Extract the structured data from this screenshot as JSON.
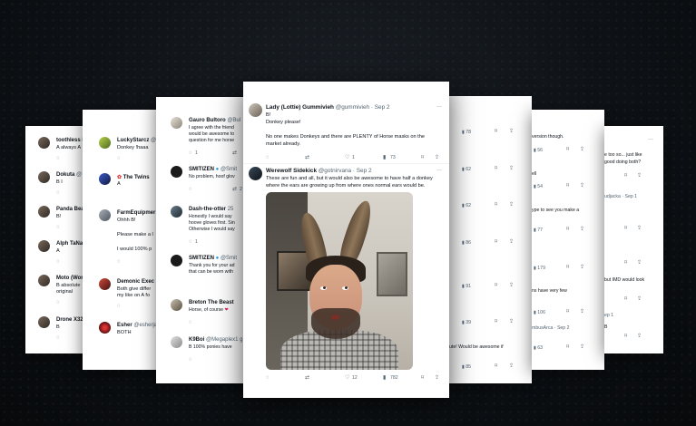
{
  "c1": {
    "tweets": [
      {
        "name": "toothless l",
        "text": "A always A"
      },
      {
        "name": "Dokuta",
        "handle": "@",
        "text": "B I"
      },
      {
        "name": "Panda Bea",
        "text": "B!"
      },
      {
        "name": "Alph TaNa",
        "text": "A"
      },
      {
        "name": "Moto (Wor",
        "text1": "B absolute",
        "text2": "original"
      },
      {
        "name": "Drone X32",
        "text": "B"
      }
    ]
  },
  "c2": {
    "t1": {
      "name": "LuckyStarcz",
      "handle": "@",
      "text": "Donkey !haaa"
    },
    "t2": {
      "name": "The Twins",
      "text": "A"
    },
    "t3": {
      "name": "FarmEquipmer",
      "text1": "Ohhh B!",
      "text2": "Please make a l",
      "text3": "I would 100% p"
    },
    "t4": {
      "name": "Demonic Exec",
      "text1": "Both give differ",
      "text2": "my like on A fo"
    },
    "t5": {
      "name": "Esher",
      "handle": "@esherja",
      "text": "BOTH"
    }
  },
  "c3": {
    "t1": {
      "name": "Gauro Bultoro",
      "handle": "@Bul",
      "text": [
        "I agree with the friend",
        "would be awesome to",
        "question for me horse"
      ],
      "likes": "1"
    },
    "t2": {
      "name": "SMITIZEN",
      "handle": "@Smit",
      "text": "No problem, hoof glov",
      "replies": "2"
    },
    "t3": {
      "name": "Dash-the-otter",
      "handle": "25",
      "text": [
        "Honestly I would say",
        "hoove gloves first. Sin",
        "Otherwise I would say"
      ],
      "likes": "1"
    },
    "t4": {
      "name": "SMITIZEN",
      "handle": "@Smit",
      "text": [
        "Thank you for your ad",
        "that can be worn with"
      ]
    },
    "t5": {
      "name": "Breton The Beast",
      "text": "Horse, of course"
    },
    "t6": {
      "name": "K9Boi",
      "handle": "@Megaplex1",
      "text": "B 100% ponies have",
      "extra": "g"
    }
  },
  "main": {
    "t1": {
      "name": "Lady (Lottie) Gummivieh",
      "handle": "@gummivieh · Sep 2",
      "text1": "B!",
      "text2": "Donkey please!",
      "text3": "No one makes Donkeys and there are PLENTY of Horse masks on the",
      "text4": "market already.",
      "likes": "1",
      "views": "73"
    },
    "t2": {
      "name": "Werewolf Sidekick",
      "handle": "@gotnirvana · Sep 2",
      "text1": "These are fun and all, but it would also be awesome to have half a donkey",
      "text2": "where the ears are growing up from where ones normal ears would be.",
      "likes": "12",
      "views": "782"
    }
  },
  "c5": {
    "views": [
      "78",
      "62",
      "62",
      "86",
      "91",
      "39",
      "85"
    ],
    "bottom_text": "ute! Would be awesome if"
  },
  "c6": {
    "lines": [
      "version though.",
      "ell",
      "ype to see you make a",
      "ns have very few",
      "mbusArca · Sep 2"
    ],
    "counts": [
      "56",
      "54",
      "77",
      "179",
      "106",
      "63"
    ]
  },
  "c7": {
    "lines": [
      "e too so... just like",
      "good doing both?",
      "udjacka · Sep 1",
      "but IMD would look",
      "ep 1",
      "B"
    ]
  },
  "icons": {
    "reply": "reply-icon",
    "retweet": "retweet-icon",
    "like": "heart-icon",
    "views": "views-icon",
    "bookmark": "bookmark-icon",
    "share": "share-icon",
    "more": "more-icon",
    "verified": "verified-icon"
  }
}
